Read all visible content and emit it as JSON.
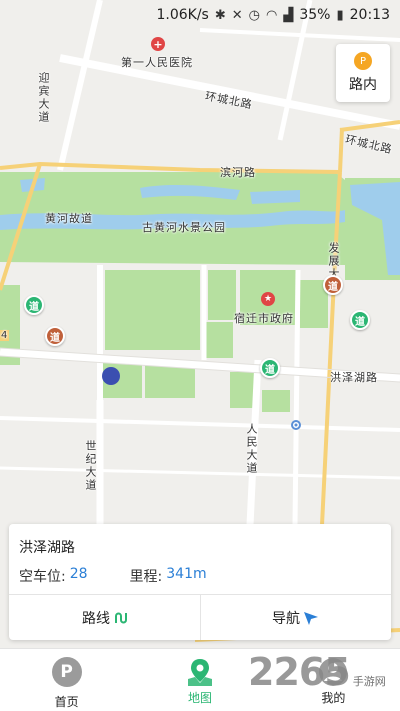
{
  "status_bar": {
    "speed": "1.06K/s",
    "battery": "35%",
    "time": "20:13",
    "icons": [
      "bluetooth-icon",
      "mute-icon",
      "alarm-icon",
      "wifi-icon",
      "signal-icon",
      "battery-icon"
    ]
  },
  "map": {
    "labels": {
      "hospital": "第一人民医院",
      "huancheng_north_1": "环城北路",
      "huancheng_north_2": "环城北路",
      "yingbin_avenue": "迎宾大道",
      "binhe_road": "滨河路",
      "huanghe_gudao": "黄河故道",
      "park": "古黄河水景公园",
      "fazhan_avenue": "发展大道",
      "city_government": "宿迁市政府",
      "hongzehu_road": "洪泽湖路",
      "shiji_avenue": "世纪大道",
      "renmin_avenue": "人民大道",
      "edge_number": "4"
    },
    "poi_marker_text": "道",
    "colors": {
      "background": "#f0efec",
      "road": "#ffffff",
      "water": "#9fcdec",
      "green": "#b6e0a0",
      "major_road": "#f6d178",
      "accent_green": "#2bb673",
      "accent_blue": "#2b7fd6"
    }
  },
  "road_button": {
    "icon": "parking-pin-icon",
    "label": "路内"
  },
  "info_card": {
    "road_name": "洪泽湖路",
    "vacancy_label": "空车位:",
    "vacancy_value": "28",
    "distance_label": "里程:",
    "distance_value": "341m",
    "route_label": "路线",
    "navigate_label": "导航"
  },
  "bottom_nav": {
    "items": [
      {
        "label": "首页",
        "icon": "parking-icon"
      },
      {
        "label": "地图",
        "icon": "map-pin-icon"
      },
      {
        "label": "我的",
        "icon": "user-icon"
      }
    ],
    "active": "地图"
  },
  "watermark": {
    "brand": "2265",
    "site": "手游网",
    "badge": "P"
  }
}
